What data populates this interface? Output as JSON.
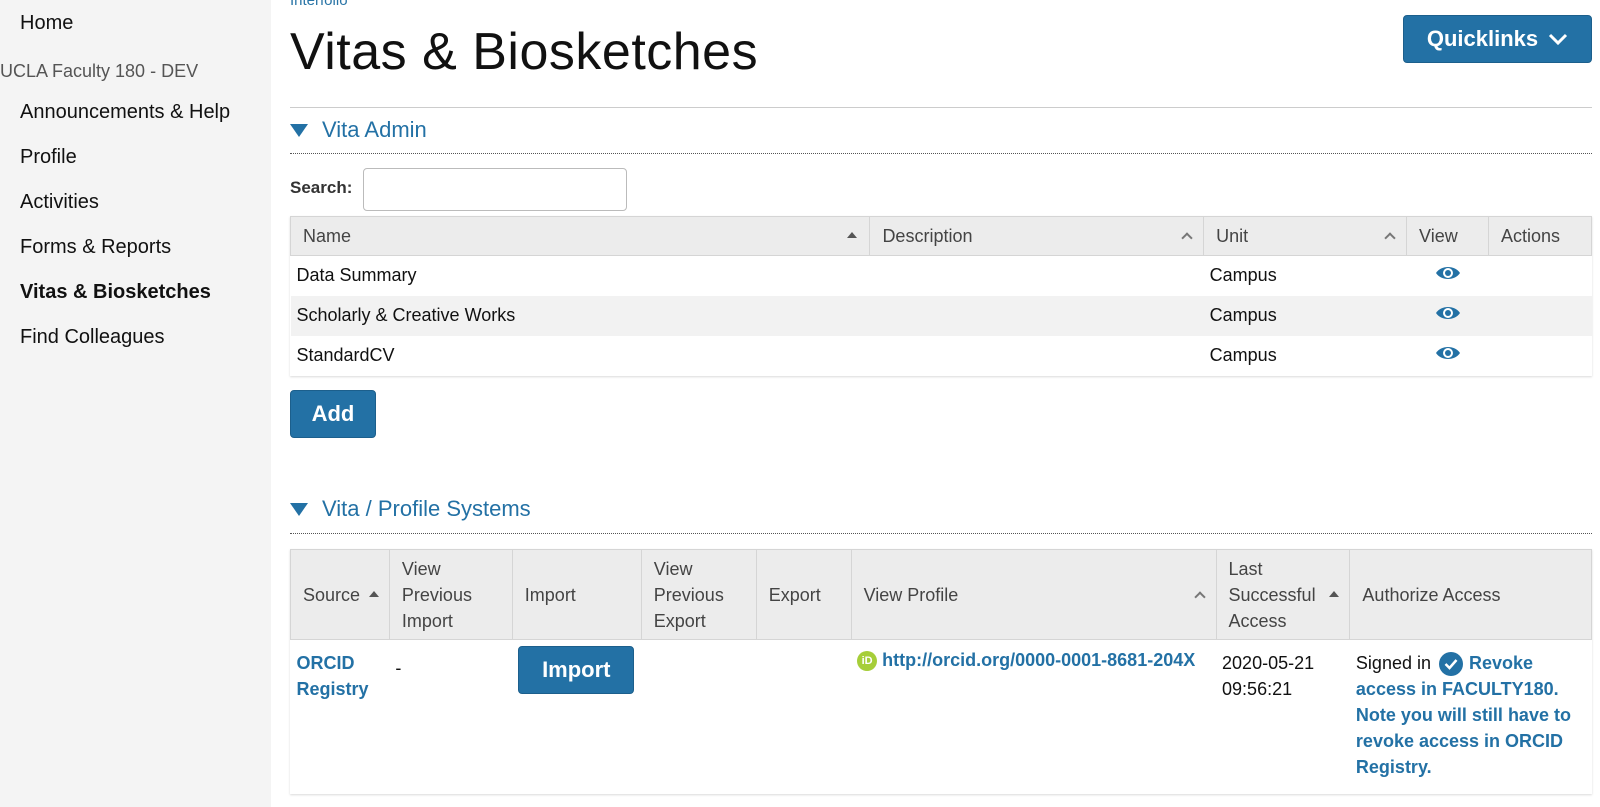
{
  "sidebar": {
    "home": "Home",
    "org": "UCLA Faculty 180 - DEV",
    "items": [
      {
        "label": "Announcements & Help"
      },
      {
        "label": "Profile"
      },
      {
        "label": "Activities"
      },
      {
        "label": "Forms & Reports"
      },
      {
        "label": "Vitas & Biosketches"
      },
      {
        "label": "Find Colleagues"
      }
    ],
    "active": "Vitas & Biosketches"
  },
  "header": {
    "breadcrumb": "Interfolio",
    "title": "Vitas & Biosketches",
    "quicklinks_label": "Quicklinks"
  },
  "vita_admin": {
    "title": "Vita Admin",
    "search_label": "Search:",
    "search_value": "",
    "columns": [
      "Name",
      "Description",
      "Unit",
      "View",
      "Actions"
    ],
    "rows": [
      {
        "name": "Data Summary",
        "description": "",
        "unit": "Campus"
      },
      {
        "name": "Scholarly & Creative Works",
        "description": "",
        "unit": "Campus"
      },
      {
        "name": "StandardCV",
        "description": "",
        "unit": "Campus"
      }
    ],
    "add_label": "Add"
  },
  "profile_systems": {
    "title": "Vita / Profile Systems",
    "columns": {
      "source": "Source",
      "view_prev_import": "View Previous Import",
      "import": "Import",
      "view_prev_export": "View Previous Export",
      "export": "Export",
      "view_profile": "View Profile",
      "last_access": "Last Successful Access",
      "authorize": "Authorize Access"
    },
    "row": {
      "source": "ORCID Registry",
      "view_prev_import": "-",
      "import_label": "Import",
      "view_prev_export": "",
      "export": "",
      "orcid_badge": "iD",
      "profile_url": "http://orcid.org/0000-0001-8681-204X",
      "last_access_date": "2020-05-21",
      "last_access_time": "09:56:21",
      "signed_in": "Signed in",
      "revoke": "Revoke access in FACULTY180. Note you will still have to revoke access in ORCID Registry."
    }
  },
  "colors": {
    "accent": "#2371a5",
    "sidebar_bg": "#f4f4f4",
    "header_bg": "#ececec",
    "orcid_green": "#a6ce39"
  },
  "icons": [
    "eye-icon",
    "chevron-down-icon",
    "collapse-triangle-icon",
    "sort-icon",
    "orcid-icon",
    "check-circle-icon"
  ]
}
